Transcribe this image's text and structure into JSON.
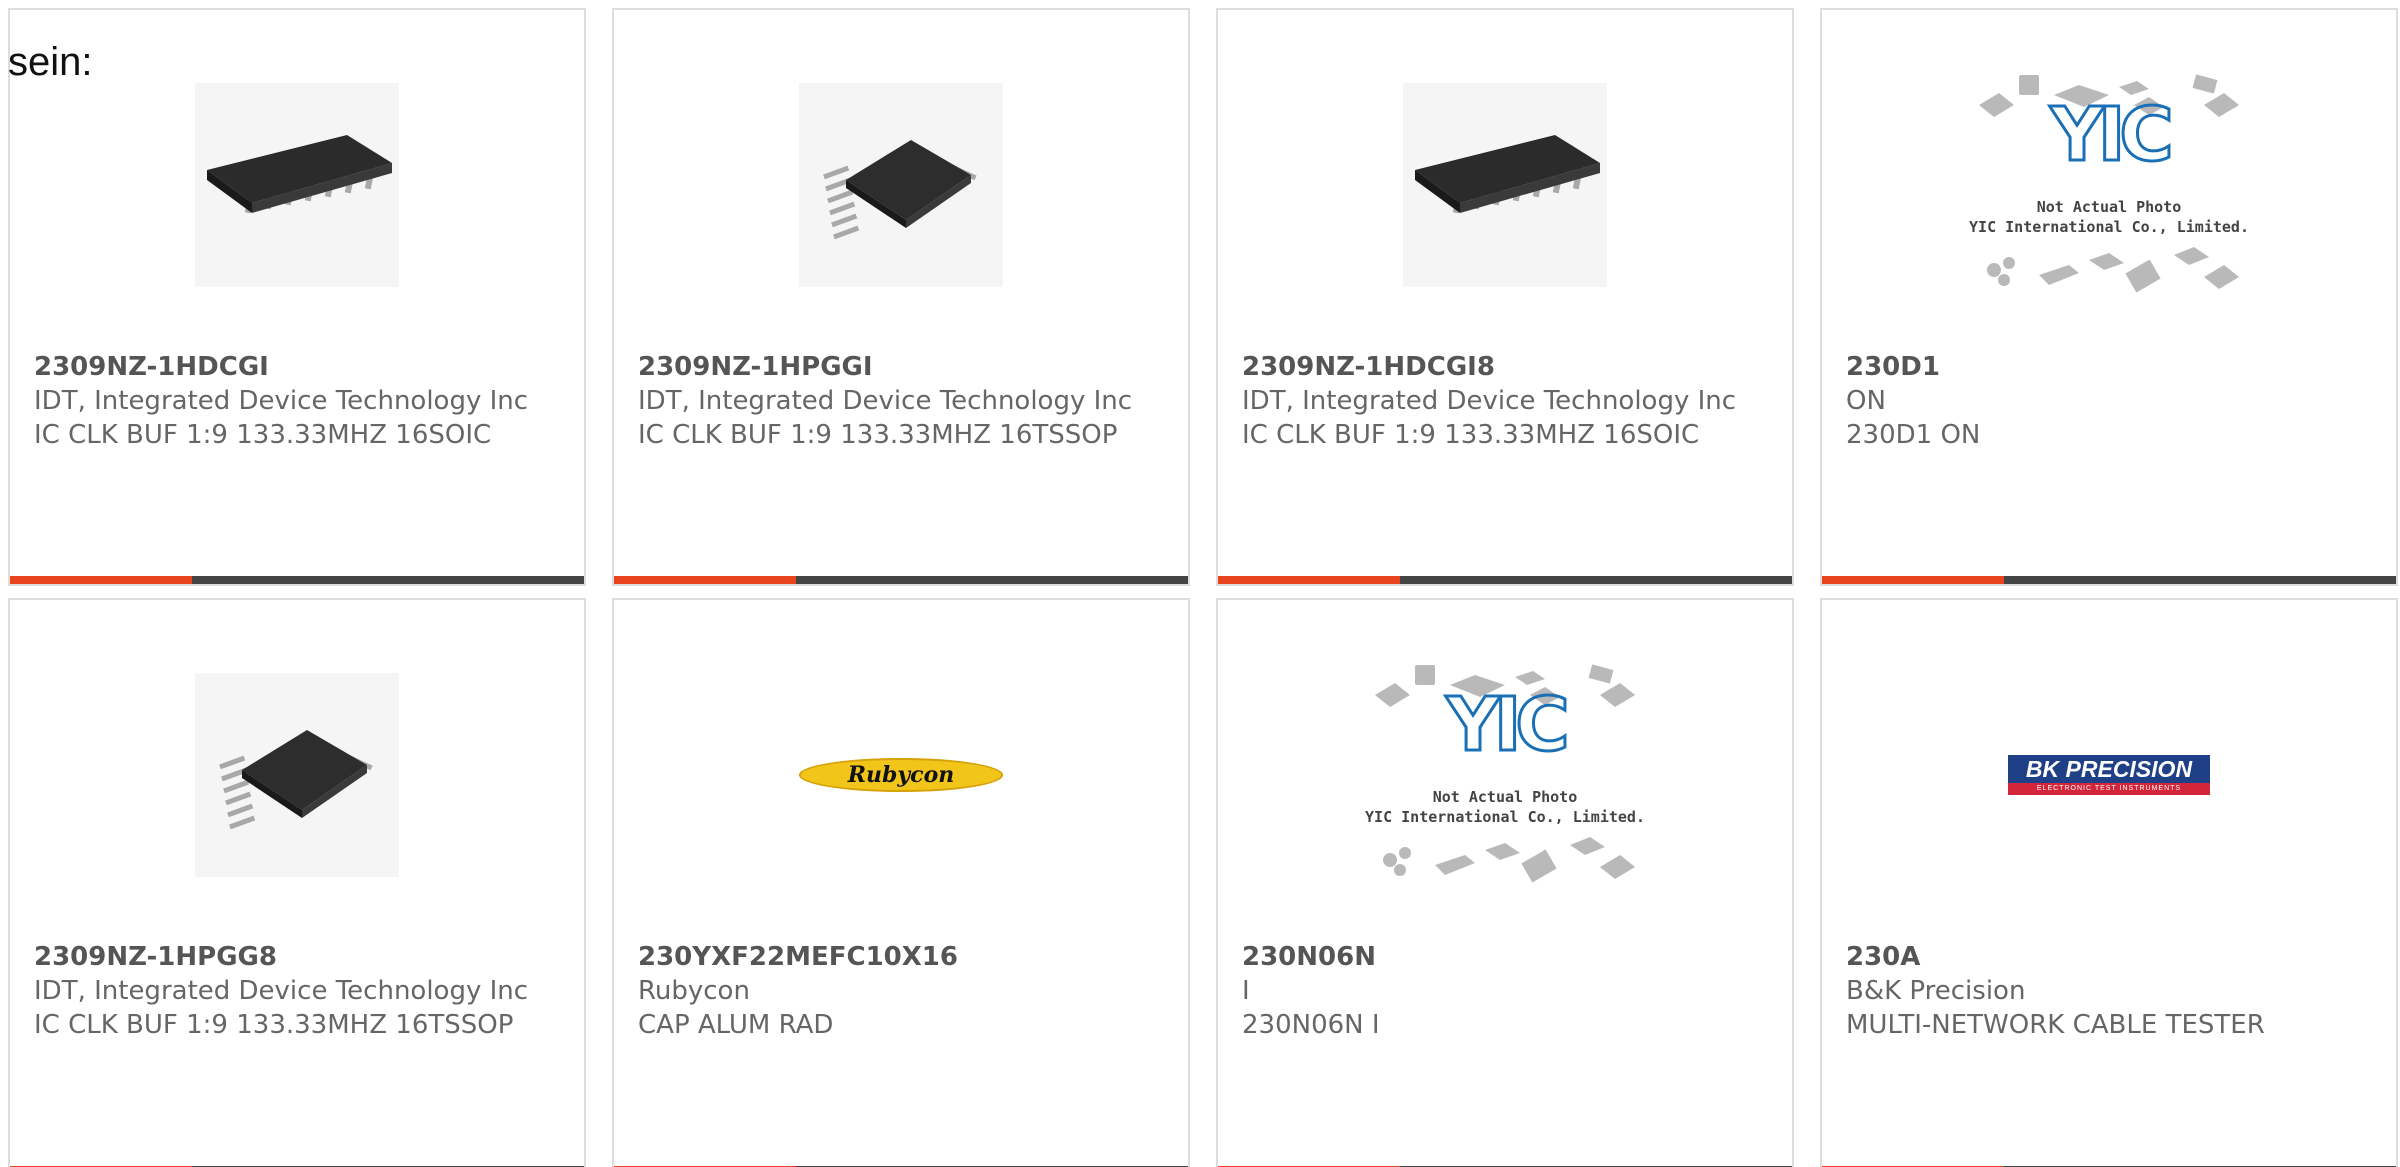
{
  "intro_text": "sein:",
  "colors": {
    "accent": "#e8451e",
    "bar": "#444444",
    "text": "#666666",
    "card_border": "#dddddd"
  },
  "products": [
    {
      "part_number": "2309NZ-1HDCGI",
      "manufacturer": "IDT, Integrated Device Technology Inc",
      "description": "IC CLK BUF 1:9 133.33MHZ 16SOIC",
      "image_type": "soic-chip-photo"
    },
    {
      "part_number": "2309NZ-1HPGGI",
      "manufacturer": "IDT, Integrated Device Technology Inc",
      "description": "IC CLK BUF 1:9 133.33MHZ 16TSSOP",
      "image_type": "tssop-chip-photo"
    },
    {
      "part_number": "2309NZ-1HDCGI8",
      "manufacturer": "IDT, Integrated Device Technology Inc",
      "description": "IC CLK BUF 1:9 133.33MHZ 16SOIC",
      "image_type": "soic-chip-photo"
    },
    {
      "part_number": "230D1",
      "manufacturer": "ON",
      "description": "230D1 ON",
      "image_type": "placeholder-not-actual-photo",
      "placeholder": {
        "logo": "YIC",
        "line1": "Not Actual Photo",
        "line2": "YIC International Co., Limited."
      }
    },
    {
      "part_number": "2309NZ-1HPGG8",
      "manufacturer": "IDT, Integrated Device Technology Inc",
      "description": "IC CLK BUF 1:9 133.33MHZ 16TSSOP",
      "image_type": "tssop-chip-photo"
    },
    {
      "part_number": "230YXF22MEFC10X16",
      "manufacturer": "Rubycon",
      "description": "CAP ALUM RAD",
      "image_type": "rubycon-logo",
      "logo_text": "Rubycon"
    },
    {
      "part_number": "230N06N",
      "manufacturer": "I",
      "description": "230N06N I",
      "image_type": "placeholder-not-actual-photo",
      "placeholder": {
        "logo": "YIC",
        "line1": "Not Actual Photo",
        "line2": "YIC International Co., Limited."
      }
    },
    {
      "part_number": "230A",
      "manufacturer": "B&K Precision",
      "description": "MULTI-NETWORK CABLE TESTER",
      "image_type": "bk-precision-logo",
      "logo_text": "BK PRECISION",
      "logo_subtext": "ELECTRONIC TEST INSTRUMENTS"
    }
  ]
}
